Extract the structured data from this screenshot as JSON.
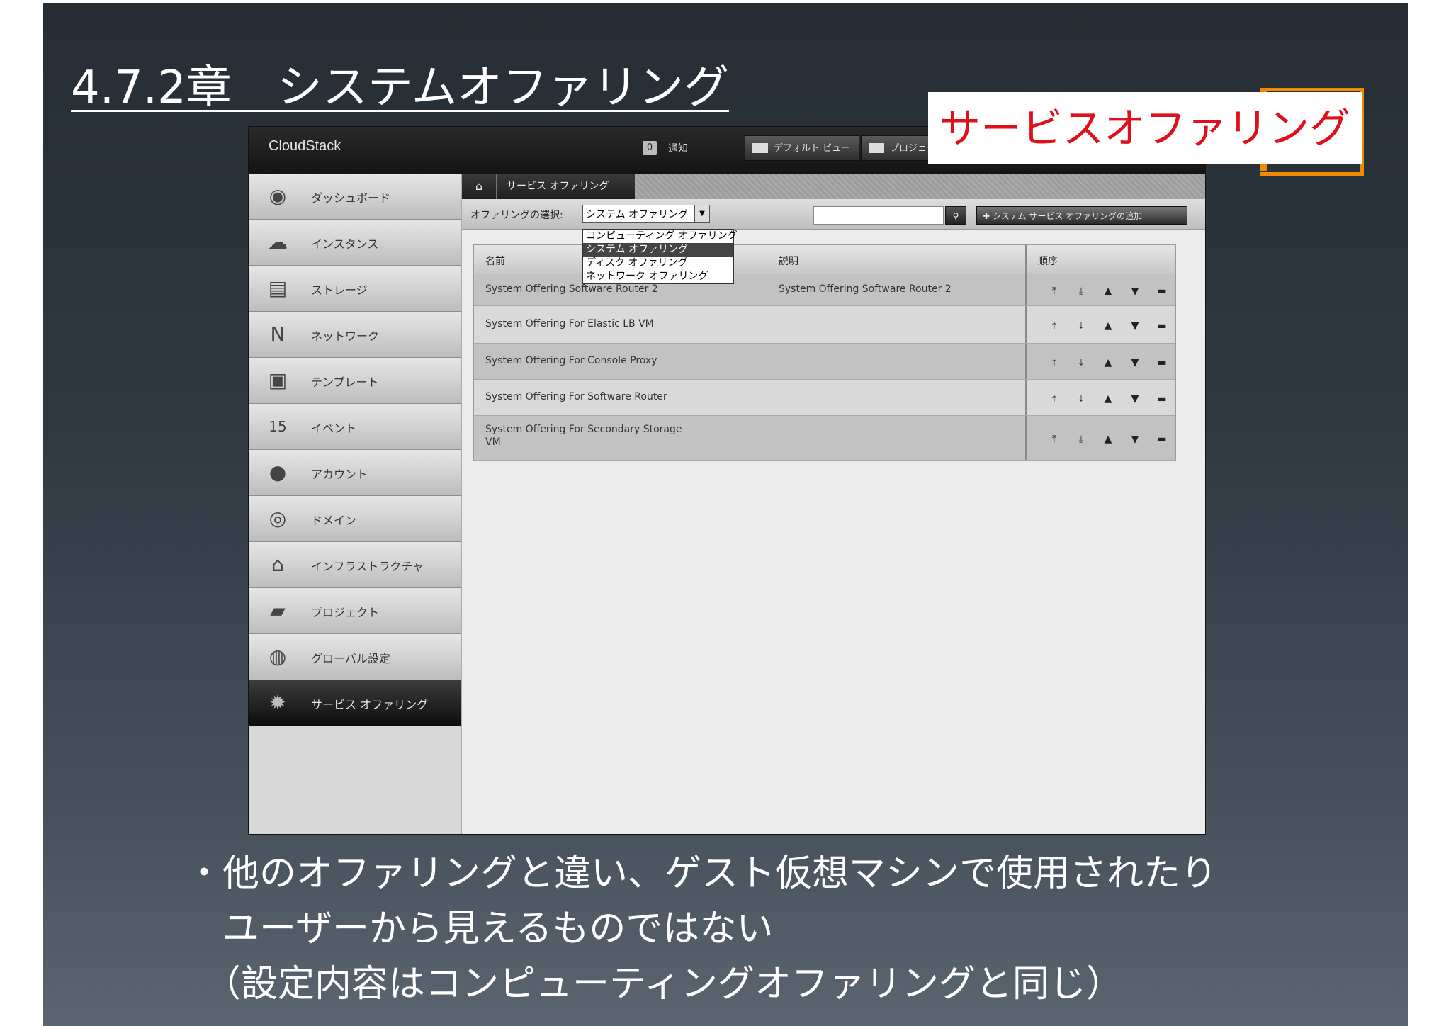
{
  "slide": {
    "title": "4.7.2章　システムオファリング",
    "callout": "サービスオファリング",
    "bullet_lines": [
      "・他のオファリングと違い、ゲスト仮想マシンで使用されたり",
      "　ユーザーから見えるものではない",
      "　（設定内容はコンピューティングオファリングと同じ）"
    ]
  },
  "app": {
    "brand": "CloudStack",
    "notifications": {
      "count": "0",
      "label": "通知"
    },
    "views": {
      "default_view": "デフォルト ビュー",
      "project_view": "プロジェクト ビュー"
    },
    "sidebar": [
      {
        "label": "ダッシュボード",
        "icon": "dashboard-icon",
        "glyph": "◉"
      },
      {
        "label": "インスタンス",
        "icon": "cloud-icon",
        "glyph": "☁"
      },
      {
        "label": "ストレージ",
        "icon": "storage-icon",
        "glyph": "▤"
      },
      {
        "label": "ネットワーク",
        "icon": "network-icon",
        "glyph": "N"
      },
      {
        "label": "テンプレート",
        "icon": "template-icon",
        "glyph": "▣"
      },
      {
        "label": "イベント",
        "icon": "calendar-icon",
        "glyph": "15"
      },
      {
        "label": "アカウント",
        "icon": "user-icon",
        "glyph": "●"
      },
      {
        "label": "ドメイン",
        "icon": "domain-icon",
        "glyph": "◎"
      },
      {
        "label": "インフラストラクチャ",
        "icon": "infrastructure-icon",
        "glyph": "⌂"
      },
      {
        "label": "プロジェクト",
        "icon": "folder-icon",
        "glyph": "▰"
      },
      {
        "label": "グローバル設定",
        "icon": "globe-icon",
        "glyph": "◍"
      },
      {
        "label": "サービス オファリング",
        "icon": "gear-icon",
        "glyph": "✹"
      }
    ],
    "active_nav_index": 11,
    "breadcrumb": {
      "home_icon": "home-icon",
      "current": "サービス オファリング"
    },
    "toolbar": {
      "select_label": "オファリングの選択:",
      "select_value": "システム オファリング",
      "options": [
        "コンピューティング オファリング",
        "システム オファリング",
        "ディスク オファリング",
        "ネットワーク オファリング"
      ],
      "selected_option_index": 1,
      "add_button": "システム サービス オファリングの追加"
    },
    "table": {
      "columns": [
        "名前",
        "説明",
        "順序"
      ],
      "rows": [
        {
          "name": "System Offering Software Router 2",
          "description": "System Offering Software Router 2"
        },
        {
          "name": "System Offering For Elastic LB VM",
          "description": ""
        },
        {
          "name": "System Offering For Console Proxy",
          "description": ""
        },
        {
          "name": "System Offering For Software Router",
          "description": ""
        },
        {
          "name": "System Offering For Secondary Storage VM",
          "description": ""
        }
      ],
      "order_actions": [
        {
          "name": "move-top-icon",
          "glyph": "⤒"
        },
        {
          "name": "move-bottom-icon",
          "glyph": "⤓"
        },
        {
          "name": "move-up-icon",
          "glyph": "▲"
        },
        {
          "name": "move-down-icon",
          "glyph": "▼"
        },
        {
          "name": "drag-handle-icon",
          "glyph": "▬"
        }
      ]
    },
    "colors": {
      "active_nav": "#1a1a1a",
      "callout_text": "#e0101a",
      "callout_border": "#f08a00"
    }
  }
}
